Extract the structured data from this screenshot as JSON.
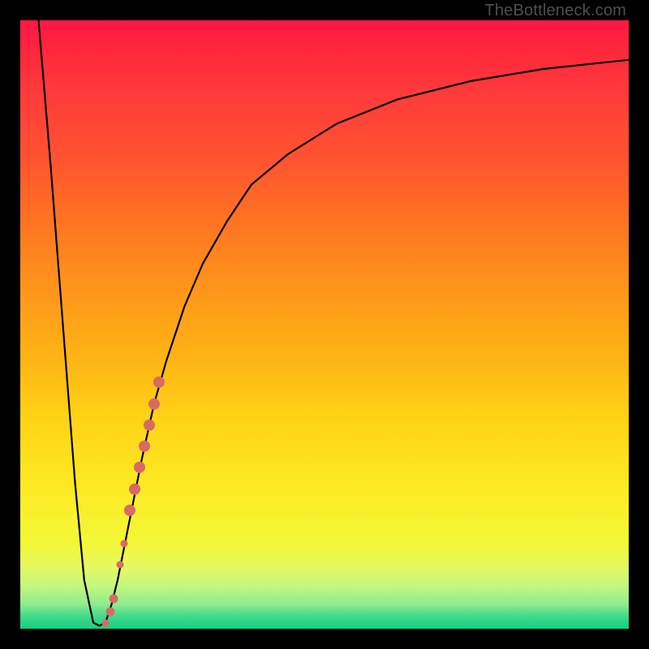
{
  "watermark": "TheBottleneck.com",
  "colors": {
    "dot": "#d96a63",
    "curve": "#000000",
    "frame": "#000000"
  },
  "chart_data": {
    "type": "line",
    "title": "",
    "xlabel": "",
    "ylabel": "",
    "xlim": [
      0,
      100
    ],
    "ylim": [
      0,
      100
    ],
    "grid": false,
    "series": [
      {
        "name": "bottleneck-curve",
        "x": [
          3,
          5,
          7,
          9,
          10.5,
          12,
          13,
          14,
          15,
          16,
          18,
          20,
          22,
          24,
          27,
          30,
          34,
          38,
          44,
          52,
          62,
          74,
          86,
          100
        ],
        "y": [
          100,
          76,
          50,
          24,
          8,
          1,
          0.5,
          1,
          4,
          8,
          18,
          28,
          37,
          44,
          53,
          60,
          67,
          73,
          78,
          83,
          87,
          90,
          92,
          93.5
        ]
      }
    ],
    "markers": [
      {
        "name": "cluster-bar-top",
        "x": 22.8,
        "y": 40.5,
        "size": 14
      },
      {
        "name": "cluster-bar-mid1",
        "x": 22.0,
        "y": 37.0,
        "size": 14
      },
      {
        "name": "cluster-bar-mid2",
        "x": 21.2,
        "y": 33.5,
        "size": 14
      },
      {
        "name": "cluster-bar-mid3",
        "x": 20.4,
        "y": 30.0,
        "size": 14
      },
      {
        "name": "cluster-bar-mid4",
        "x": 19.6,
        "y": 26.5,
        "size": 14
      },
      {
        "name": "cluster-bar-mid5",
        "x": 18.8,
        "y": 23.0,
        "size": 14
      },
      {
        "name": "cluster-bar-bot",
        "x": 18.0,
        "y": 19.5,
        "size": 14
      },
      {
        "name": "dot-mid-1",
        "x": 17.0,
        "y": 14.0,
        "size": 9
      },
      {
        "name": "dot-mid-2",
        "x": 16.4,
        "y": 10.5,
        "size": 9
      },
      {
        "name": "dot-low-1",
        "x": 15.3,
        "y": 5.0,
        "size": 11
      },
      {
        "name": "dot-low-2",
        "x": 14.8,
        "y": 2.8,
        "size": 11
      },
      {
        "name": "dot-bottom",
        "x": 14.0,
        "y": 1.0,
        "size": 9
      }
    ]
  }
}
